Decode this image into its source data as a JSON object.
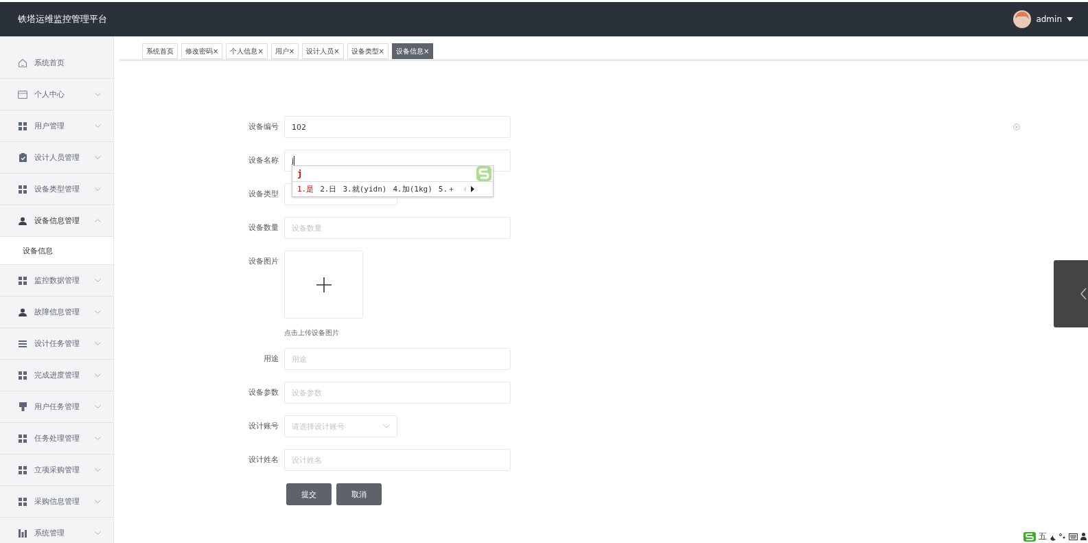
{
  "header": {
    "title": "铁塔运维监控管理平台",
    "user": "admin"
  },
  "sidebar": {
    "items": [
      {
        "label": "系统首页",
        "kind": "link"
      },
      {
        "label": "个人中心",
        "kind": "menu",
        "expanded": false
      },
      {
        "label": "用户管理",
        "kind": "menu",
        "expanded": false
      },
      {
        "label": "设计人员管理",
        "kind": "menu",
        "expanded": false
      },
      {
        "label": "设备类型管理",
        "kind": "menu",
        "expanded": false
      },
      {
        "label": "设备信息管理",
        "kind": "menu",
        "expanded": true,
        "children": [
          {
            "label": "设备信息",
            "selected": true
          }
        ]
      },
      {
        "label": "监控数据管理",
        "kind": "menu",
        "expanded": false
      },
      {
        "label": "故障信息管理",
        "kind": "menu",
        "expanded": false
      },
      {
        "label": "设计任务管理",
        "kind": "menu",
        "expanded": false
      },
      {
        "label": "完成进度管理",
        "kind": "menu",
        "expanded": false
      },
      {
        "label": "用户任务管理",
        "kind": "menu",
        "expanded": false
      },
      {
        "label": "任务处理管理",
        "kind": "menu",
        "expanded": false
      },
      {
        "label": "立项采购管理",
        "kind": "menu",
        "expanded": false
      },
      {
        "label": "采购信息管理",
        "kind": "menu",
        "expanded": false
      },
      {
        "label": "系统管理",
        "kind": "menu",
        "expanded": false
      }
    ]
  },
  "tabs": [
    {
      "label": "系统首页",
      "selected": false,
      "closable": false
    },
    {
      "label": "修改密码",
      "selected": false,
      "closable": true
    },
    {
      "label": "个人信息",
      "selected": false,
      "closable": true
    },
    {
      "label": "用户",
      "selected": false,
      "closable": true
    },
    {
      "label": "设计人员",
      "selected": false,
      "closable": true
    },
    {
      "label": "设备类型",
      "selected": false,
      "closable": true
    },
    {
      "label": "设备信息",
      "selected": true,
      "closable": true
    }
  ],
  "close_mark": "×",
  "form": {
    "fields": [
      {
        "kind": "text",
        "label": "设备编号",
        "value": "102"
      },
      {
        "kind": "composing",
        "label": "设备名称",
        "value": "j"
      },
      {
        "kind": "select",
        "label": "设备类型"
      },
      {
        "kind": "text",
        "label": "设备数量",
        "placeholder": "设备数量"
      },
      {
        "kind": "upload",
        "label": "设备图片",
        "caption": "点击上传设备图片"
      },
      {
        "kind": "text",
        "label": "用途",
        "placeholder": "用途"
      },
      {
        "kind": "text",
        "label": "设备参数",
        "placeholder": "设备参数"
      },
      {
        "kind": "select",
        "label": "设计账号",
        "placeholder": "请选择设计账号"
      },
      {
        "kind": "text",
        "label": "设计姓名",
        "placeholder": "设计姓名"
      }
    ],
    "buttons": [
      "提交",
      "取消"
    ]
  },
  "ime_popup": {
    "composition": "j",
    "candidates": [
      {
        "text": "1.是",
        "selected": true
      },
      {
        "text": "2.日",
        "selected": false
      },
      {
        "text": "3.就(yidn)",
        "selected": false
      },
      {
        "text": "4.加(1kg)",
        "selected": false
      },
      {
        "text": "5.＋",
        "selected": false
      }
    ]
  },
  "ime_status": {
    "mode": "五"
  }
}
